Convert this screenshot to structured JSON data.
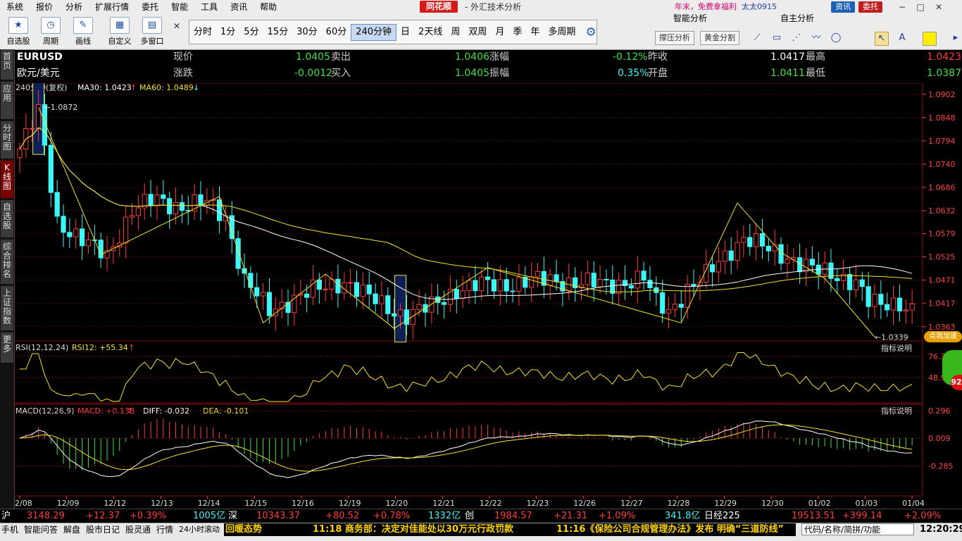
{
  "menu": {
    "items": [
      "系统",
      "报价",
      "分析",
      "扩展行情",
      "委托",
      "智能",
      "工具",
      "资讯",
      "帮助"
    ],
    "brand": "同花顺",
    "app_title": "- 外汇技术分析",
    "promo": "年末，免费拿福利",
    "user": "太太0915",
    "news_btn": "资讯",
    "trade_btn": "委托"
  },
  "toolbar": {
    "groups": [
      "自选股",
      "周期",
      "画线",
      "自定义",
      "多窗口"
    ],
    "periods": [
      "分时",
      "1分",
      "5分",
      "15分",
      "30分",
      "60分",
      "240分钟",
      "日",
      "2天线",
      "周",
      "双周",
      "月",
      "季",
      "年",
      "多周期"
    ],
    "active_period": "240分钟",
    "smart_title": "智能分析",
    "self_title": "自主分析",
    "btn_pressure": "撑压分析",
    "btn_golden": "黄金分割"
  },
  "lefttabs": [
    "首页",
    "应用",
    "分时图",
    "K线图",
    "自选股",
    "综合排名",
    "上证指数",
    "更多"
  ],
  "quote": {
    "symbol": "EURUSD",
    "name": "欧元/美元",
    "row1": [
      {
        "label": "现价",
        "value": "1.0405"
      },
      {
        "label": "卖出",
        "value": "1.0406"
      },
      {
        "label": "涨幅",
        "value": "-0.12%"
      },
      {
        "label": "昨收",
        "value": "1.0417"
      },
      {
        "label": "最高",
        "value": "1.0423"
      }
    ],
    "row2": [
      {
        "label": "涨跌",
        "value": "-0.0012"
      },
      {
        "label": "买入",
        "value": "1.0405"
      },
      {
        "label": "振幅",
        "value": "0.35%"
      },
      {
        "label": "开盘",
        "value": "1.0411"
      },
      {
        "label": "最低",
        "value": "1.0387"
      }
    ]
  },
  "colors": {
    "up": "#ff3b3b",
    "down": "#3ff6f6",
    "ma30": "#ffffff",
    "ma60": "#f2e22c",
    "grid": "#8a1010",
    "axis": "#ff4444",
    "zigzag": "#f2e22c"
  },
  "chart_data": {
    "type": "candlestick",
    "period_label": "240分钟(复权)",
    "ma30_label": "MA30: 1.0423",
    "ma60_label": "MA60: 1.0489",
    "ylim": [
      1.033,
      1.0905
    ],
    "y_ticks": [
      "1.0902",
      "1.0848",
      "1.0794",
      "1.0740",
      "1.0686",
      "1.0632",
      "1.0579",
      "1.0525",
      "1.0471",
      "1.0417",
      "1.0363"
    ],
    "x_ticks": [
      "12/08",
      "12/09",
      "12/12",
      "12/13",
      "12/14",
      "12/15",
      "12/16",
      "12/19",
      "12/20",
      "12/21",
      "12/22",
      "12/23",
      "12/26",
      "12/27",
      "12/28",
      "12/29",
      "12/30",
      "01/02",
      "01/03",
      "01/04"
    ],
    "high_label": "1.0872",
    "low_label": "1.0339",
    "highlight_bars": [
      3,
      61
    ],
    "anchors": [
      [
        0,
        1.0775
      ],
      [
        3,
        1.086
      ],
      [
        6,
        1.061
      ],
      [
        10,
        1.056
      ],
      [
        14,
        1.053
      ],
      [
        18,
        1.063
      ],
      [
        22,
        1.066
      ],
      [
        26,
        1.064
      ],
      [
        30,
        1.065
      ],
      [
        33,
        1.062
      ],
      [
        36,
        1.047
      ],
      [
        40,
        1.04
      ],
      [
        44,
        1.043
      ],
      [
        48,
        1.045
      ],
      [
        52,
        1.047
      ],
      [
        56,
        1.043
      ],
      [
        60,
        1.04
      ],
      [
        62,
        1.039
      ],
      [
        66,
        1.041
      ],
      [
        70,
        1.045
      ],
      [
        74,
        1.046
      ],
      [
        78,
        1.046
      ],
      [
        82,
        1.047
      ],
      [
        86,
        1.047
      ],
      [
        90,
        1.0465
      ],
      [
        94,
        1.046
      ],
      [
        98,
        1.047
      ],
      [
        100,
        1.0475
      ],
      [
        102,
        1.042
      ],
      [
        104,
        1.04
      ],
      [
        107,
        1.045
      ],
      [
        110,
        1.048
      ],
      [
        113,
        1.053
      ],
      [
        116,
        1.057
      ],
      [
        120,
        1.054
      ],
      [
        124,
        1.052
      ],
      [
        128,
        1.049
      ],
      [
        131,
        1.048
      ],
      [
        134,
        1.047
      ],
      [
        136,
        1.042
      ],
      [
        138,
        1.041
      ],
      [
        141,
        1.042
      ],
      [
        143,
        1.0405
      ]
    ],
    "zigzag": [
      [
        3,
        1.0872
      ],
      [
        13,
        1.053
      ],
      [
        32,
        1.0665
      ],
      [
        39,
        1.0372
      ],
      [
        49,
        1.0485
      ],
      [
        60,
        1.0359
      ],
      [
        75,
        1.05
      ],
      [
        106,
        1.0372
      ],
      [
        115,
        1.065
      ],
      [
        122,
        1.0535
      ],
      [
        129,
        1.0475
      ],
      [
        137,
        1.0339
      ]
    ],
    "rsi": {
      "label": "RSI(12,12,24)",
      "value_label": "RSI12: +55.34",
      "y_ticks": [
        "76.31",
        "48.93"
      ],
      "help": "指标说明"
    },
    "macd": {
      "label": "MACD(12,26,9)",
      "macd_label": "MACD: +0.138",
      "diff_label": "DIFF: -0.032",
      "dea_label": "DEA: -0.101",
      "y_ticks": [
        "0.296",
        "0.009",
        "-0.285"
      ],
      "help": "指标说明"
    }
  },
  "status": {
    "sh": {
      "name": "沪",
      "price": "3148.29",
      "chg": "+12.37",
      "pct": "+0.39%",
      "vol": "1005亿"
    },
    "sz": {
      "name": "深",
      "price": "10343.37",
      "chg": "+80.52",
      "pct": "+0.78%",
      "vol": "1332亿"
    },
    "cy": {
      "name": "创",
      "price": "1984.57",
      "chg": "+21.31",
      "pct": "+1.09%",
      "vol": "341.8亿"
    },
    "nk": {
      "name": "日经225",
      "price": "19513.51",
      "chg": "+399.14",
      "pct": "+2.09%"
    }
  },
  "bottom": {
    "tabs": [
      "手机",
      "智能问答",
      "解盘",
      "股市日记",
      "股灵通",
      "行情",
      "24小时滚动"
    ],
    "news": [
      "回暖态势",
      "11:18 商务部：决定对佳能处以30万元行政罚款",
      "11:16《保险公司合规管理办法》发布 明确“三道防线”"
    ],
    "search_placeholder": "代码/名称/简拼/功能",
    "clock": "12:20:29"
  },
  "side": {
    "badge": "点我加速",
    "num": "92"
  }
}
